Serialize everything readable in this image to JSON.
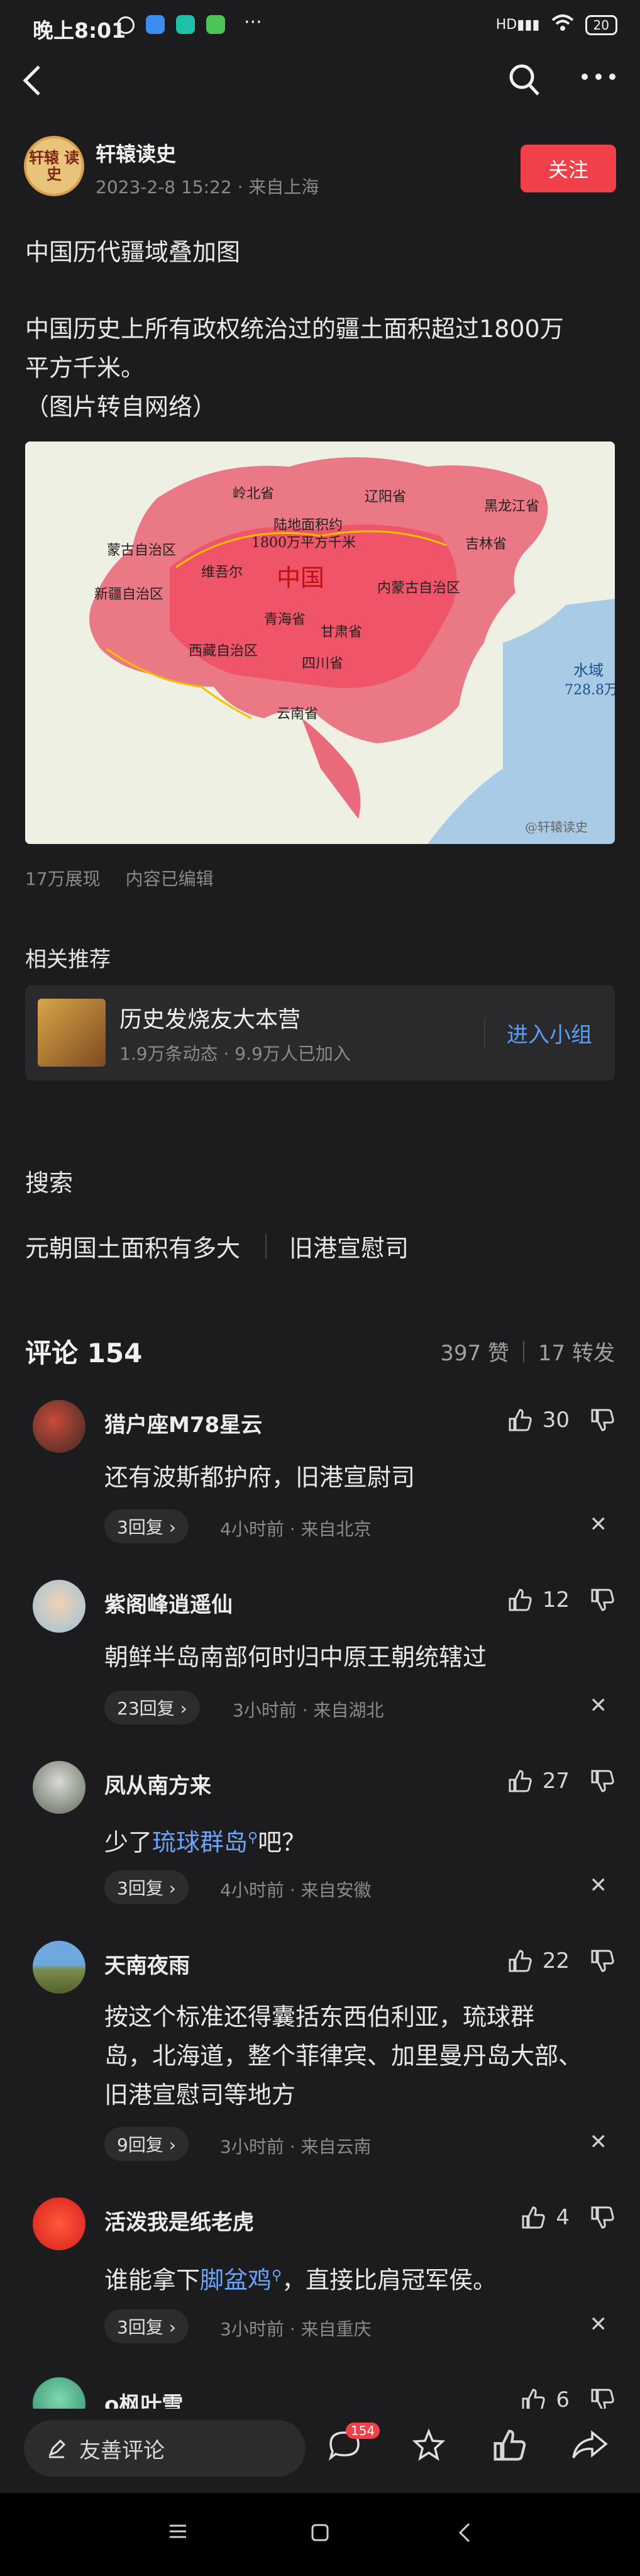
{
  "status_bar": {
    "time": "晚上8:01",
    "icons_left": [
      "alarm-icon",
      "app-icon-blue",
      "app-icon-teal",
      "app-icon-green",
      "more-icon"
    ],
    "battery": "20"
  },
  "header": {
    "back": "back-icon",
    "search": "search-icon",
    "more": "more-icon"
  },
  "author": {
    "avatar_text": "轩辕 读史",
    "name": "轩辕读史",
    "meta": "2023-2-8 15:22 · 来自上海",
    "follow_label": "关注"
  },
  "post": {
    "title": "中国历代疆域叠加图",
    "body_line1": "中国历史上所有政权统治过的疆土面积超过1800万",
    "body_line2": "平方千米。",
    "body_line3": "（图片转自网络）",
    "map_center_label": "陆地面积约",
    "map_center_label2": "1800万平方千米",
    "map_china": "中国",
    "map_water_label": "水域",
    "map_water_value": "728.8万",
    "watermark": "@轩辕读史",
    "map_regions": [
      "岭北省",
      "辽阳省",
      "黑龙江省",
      "吉林省",
      "蒙古自治区",
      "维吾尔",
      "新疆自治区",
      "内蒙古自治区",
      "青海省",
      "西藏自治区",
      "四川省",
      "云南省",
      "甘肃省"
    ],
    "views": "17万展现",
    "edited": "内容已编辑"
  },
  "related": {
    "label": "相关推荐",
    "group_name": "历史发烧友大本营",
    "group_meta": "1.9万条动态 · 9.9万人已加入",
    "join_label": "进入小组"
  },
  "search": {
    "label": "搜索",
    "terms": [
      "元朝国土面积有多大",
      "旧港宣慰司"
    ]
  },
  "comments_header": {
    "title": "评论 154",
    "likes": "397 赞",
    "shares": "17 转发"
  },
  "comments": [
    {
      "name": "猎户座M78星云",
      "likes": "30",
      "text": "还有波斯都护府，旧港宣尉司",
      "replies": "3回复 ›",
      "meta": "4小时前 · 来自北京"
    },
    {
      "name": "紫阁峰逍遥仙",
      "likes": "12",
      "text": "朝鲜半岛南部何时归中原王朝统辖过",
      "replies": "23回复 ›",
      "meta": "3小时前 · 来自湖北"
    },
    {
      "name": "凤从南方来",
      "likes": "27",
      "text_pre": "少了",
      "text_link": "琉球群岛",
      "text_post": "吧？",
      "replies": "3回复 ›",
      "meta": "4小时前 · 来自安徽"
    },
    {
      "name": "天南夜雨",
      "likes": "22",
      "text_line1": "按这个标准还得囊括东西伯利亚，琉球群",
      "text_line2": "岛，北海道，整个菲律宾、加里曼丹岛大部、",
      "text_line3": "旧港宣慰司等地方",
      "replies": "9回复 ›",
      "meta": "3小时前 · 来自云南"
    },
    {
      "name": "活泼我是纸老虎",
      "likes": "4",
      "text_pre": "谁能拿下",
      "text_link": "脚盆鸡",
      "text_post": "，直接比肩冠军侯。",
      "replies": "3回复 ›",
      "meta": "3小时前 · 来自重庆"
    },
    {
      "name": "o枫叶雪",
      "likes": "6"
    }
  ],
  "bottom_bar": {
    "comment_placeholder": "友善评论",
    "comment_badge": "154"
  },
  "colors": {
    "accent_red": "#f2404a",
    "link_blue": "#6aa3f8",
    "background": "#1c1c1e"
  }
}
